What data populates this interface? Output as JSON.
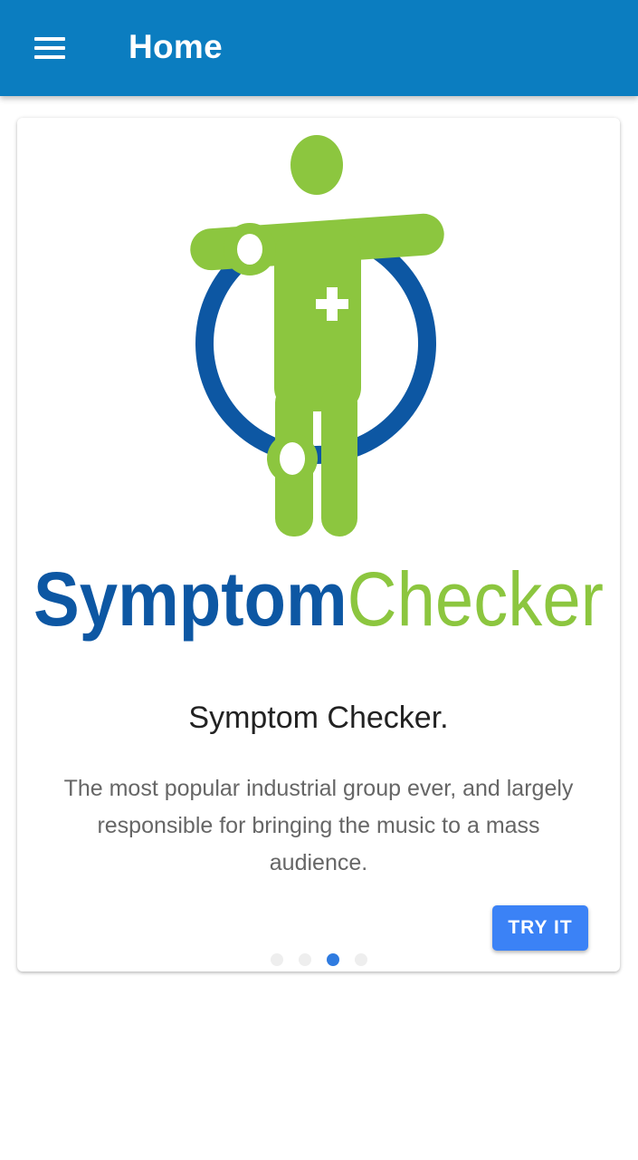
{
  "app_bar": {
    "title": "Home",
    "menu_icon": "hamburger-menu-icon",
    "background_color": "#0b7dc0"
  },
  "slide": {
    "logo": {
      "word_left": "Symptom",
      "word_right": "Checker",
      "color_left": "#0d57a3",
      "color_right": "#8cc63f"
    },
    "title": "Symptom Checker.",
    "description": "The most popular industrial group ever, and largely responsible for bringing the music to a mass audience.",
    "action_label": "TRY IT",
    "action_color": "#3b82f6"
  },
  "pager": {
    "count": 4,
    "active_index": 2,
    "active_color": "#2f7be0"
  }
}
